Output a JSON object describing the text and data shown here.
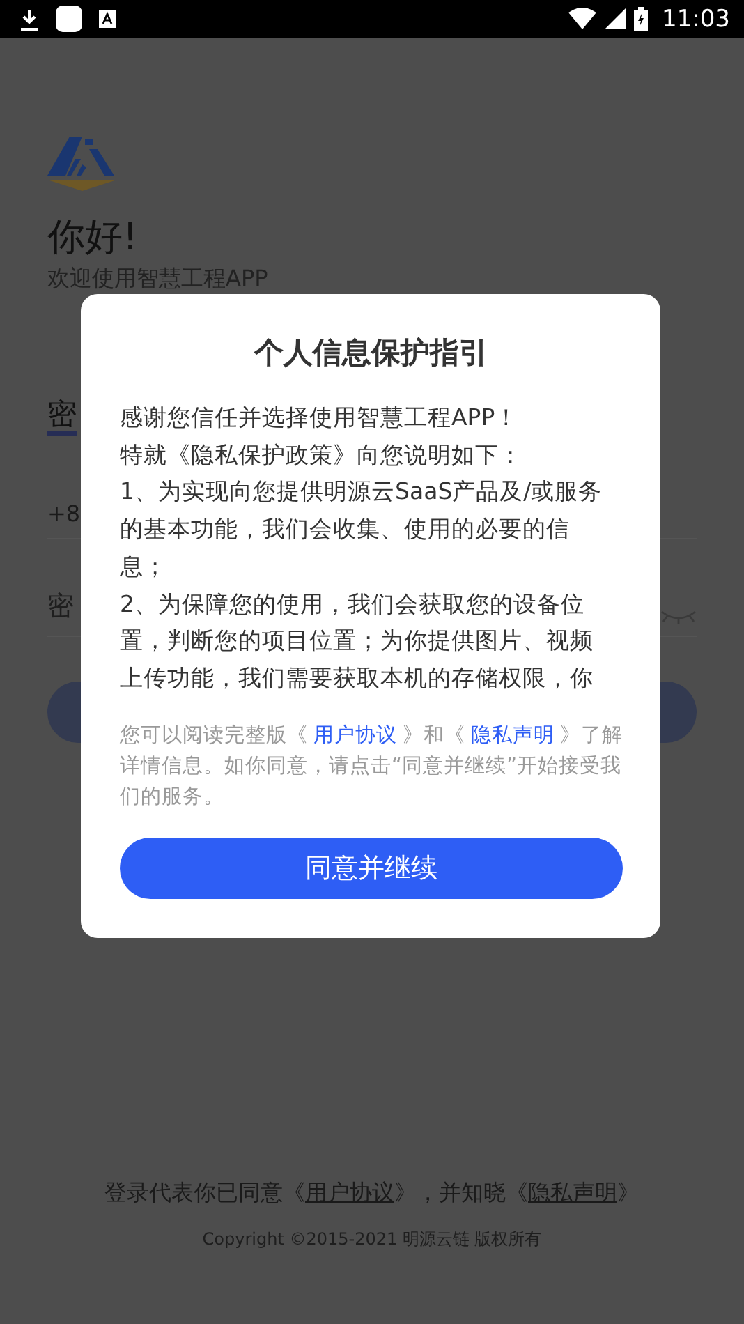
{
  "status_bar": {
    "time": "11:03"
  },
  "login": {
    "greeting": "你好!",
    "welcome": "欢迎使用智慧工程APP",
    "tab": "密",
    "phone_prefix": "+8",
    "password_placeholder": "密"
  },
  "dialog": {
    "title": "个人信息保护指引",
    "body": [
      "感谢您信任并选择使用智慧工程APP！",
      "特就《隐私保护政策》向您说明如下：",
      "1、为实现向您提供明源云SaaS产品及/或服务的基本功能，我们会收集、使用的必要的信息；",
      "2、为保障您的使用，我们会获取您的设备位置，判断您的项目位置；为你提供图片、视频上传功能，我们需要获取本机的存储权限，你"
    ],
    "notice": {
      "before": "您可以阅读完整版《",
      "link_1": "用户协议",
      "middle": "》和《",
      "link_2": "隐私声明",
      "after": "》了解详情信息。如你同意，请点击“同意并继续”开始接受我们的服务。"
    },
    "button": "同意并继续"
  },
  "footer": {
    "before": "登录代表你已同意《",
    "link_1": "用户协议",
    "middle": "》，并知晓《",
    "link_2": "隐私声明",
    "after": "》",
    "copyright": "Copyright ©2015-2021 明源云链 版权所有"
  }
}
